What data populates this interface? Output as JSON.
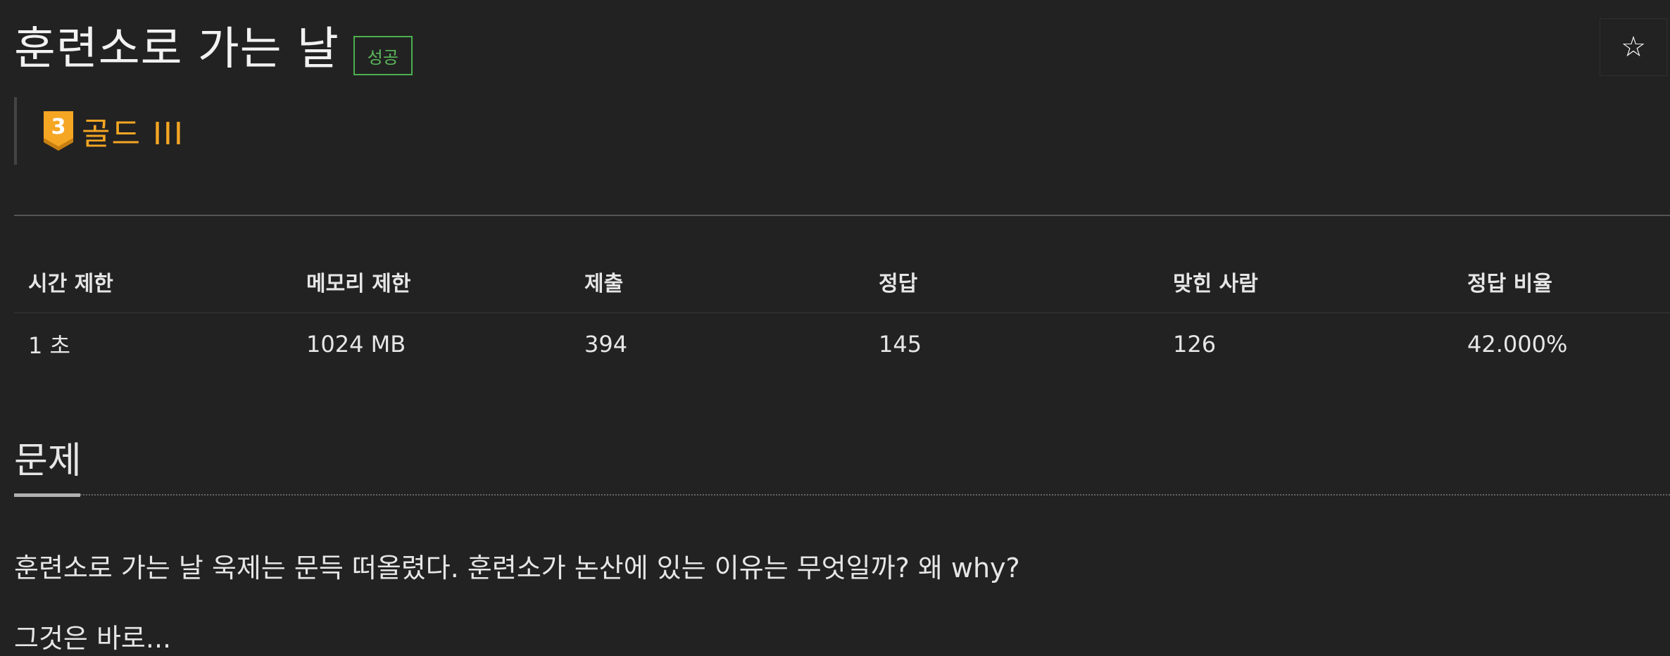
{
  "header": {
    "title": "훈련소로 가는 날",
    "status_badge": "성공",
    "star_icon": "☆"
  },
  "tier": {
    "number": "3",
    "label": "골드 III",
    "color": "#f5a623"
  },
  "stats": {
    "headers": [
      "시간 제한",
      "메모리 제한",
      "제출",
      "정답",
      "맞힌 사람",
      "정답 비율"
    ],
    "values": [
      "1 초",
      "1024 MB",
      "394",
      "145",
      "126",
      "42.000%"
    ]
  },
  "section": {
    "title": "문제"
  },
  "problem": {
    "paragraphs": [
      "훈련소로 가는 날 욱제는 문득 떠올렸다. 훈련소가 논산에 있는 이유는 무엇일까? 왜 why?",
      "그것은 바로..."
    ]
  },
  "icons": {
    "star": "star-icon",
    "tier": "gold-tier-icon"
  }
}
